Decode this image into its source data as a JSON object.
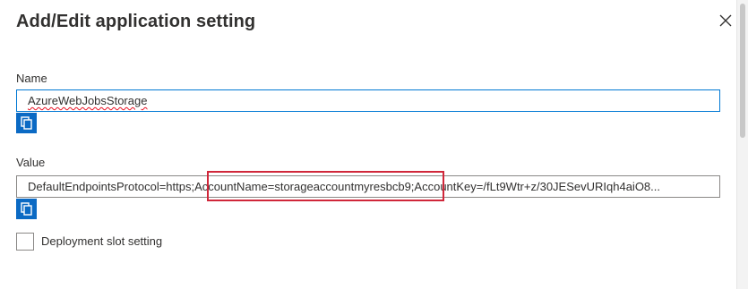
{
  "dialog": {
    "title": "Add/Edit application setting",
    "close_icon": "close-icon"
  },
  "name_field": {
    "label": "Name",
    "value": "AzureWebJobsStorage",
    "copy_icon": "copy-icon"
  },
  "value_field": {
    "label": "Value",
    "value": "DefaultEndpointsProtocol=https;AccountName=storageaccountmyresbcb9;AccountKey=/fLt9Wtr+z/30JESevURIqh4aiO8...",
    "copy_icon": "copy-icon"
  },
  "deployment_slot": {
    "label": "Deployment slot setting",
    "checked": false
  },
  "colors": {
    "accent": "#0b6ac4",
    "focus_border": "#0078d4",
    "highlight": "#d0273a"
  }
}
